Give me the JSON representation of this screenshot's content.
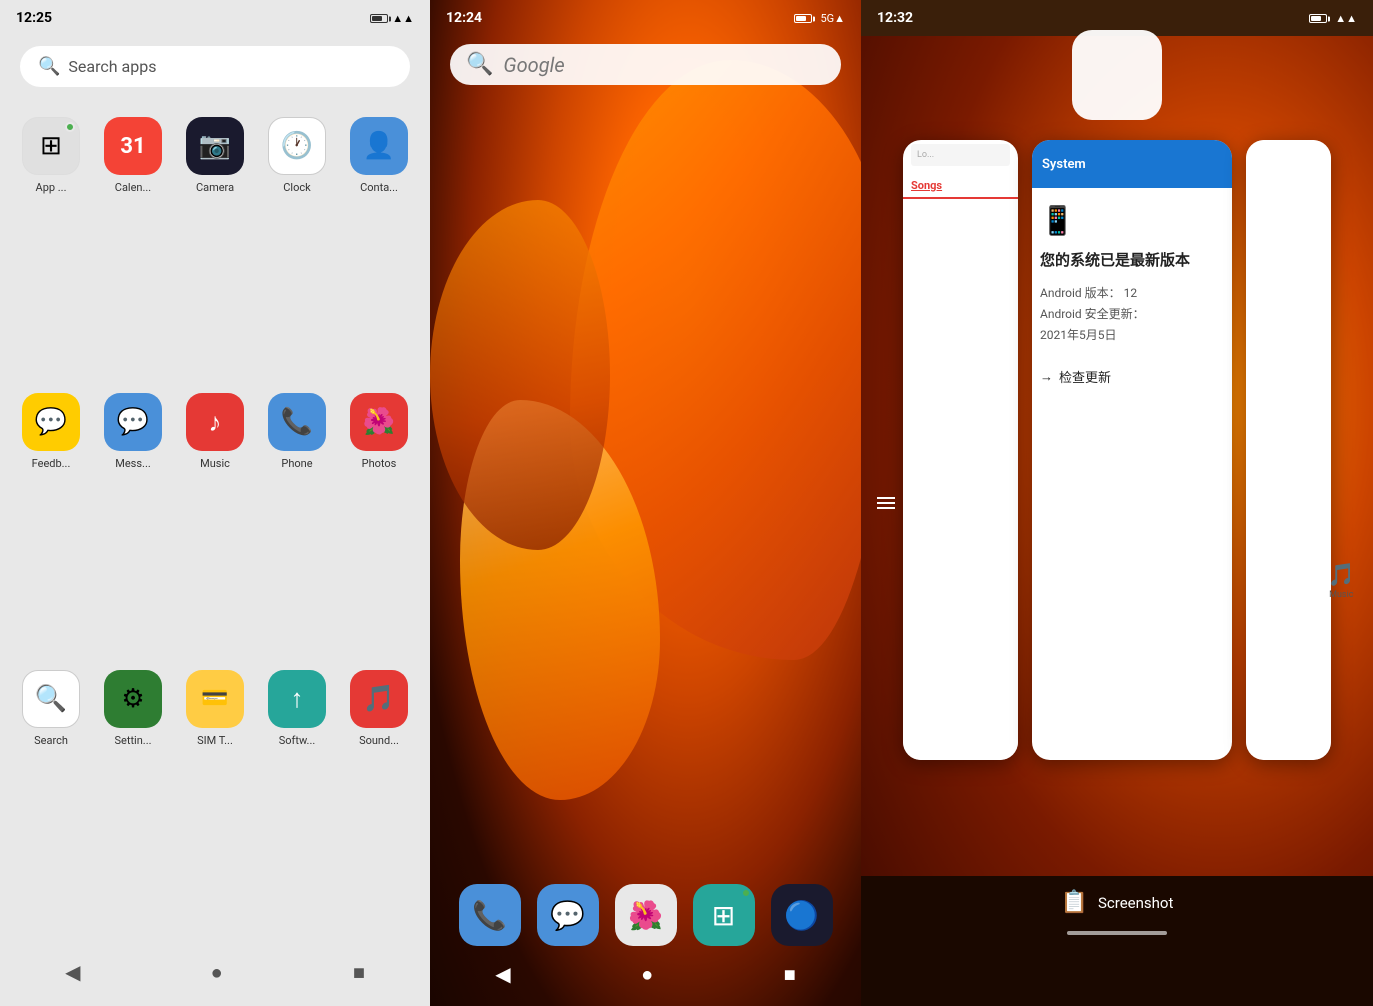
{
  "panel1": {
    "status": {
      "time": "12:25",
      "icons": "📶 🔋"
    },
    "search_placeholder": "Search apps",
    "apps": [
      {
        "id": "appstore",
        "label": "App ...",
        "icon": "⊞",
        "color": "#e8e8e8",
        "dot": true
      },
      {
        "id": "calendar",
        "label": "Calen...",
        "icon": "31",
        "color": "#f44336"
      },
      {
        "id": "camera",
        "label": "Camera",
        "icon": "📷",
        "color": "#1a1a2e"
      },
      {
        "id": "clock",
        "label": "Clock",
        "icon": "🕐",
        "color": "#ffffff"
      },
      {
        "id": "contacts",
        "label": "Conta...",
        "icon": "👤",
        "color": "#4a90d9"
      },
      {
        "id": "feedback",
        "label": "Feedb...",
        "icon": "💬",
        "color": "#ffcc00"
      },
      {
        "id": "messages",
        "label": "Mess...",
        "icon": "💬",
        "color": "#4a90d9"
      },
      {
        "id": "music",
        "label": "Music",
        "icon": "♪",
        "color": "#e53935"
      },
      {
        "id": "phone",
        "label": "Phone",
        "icon": "📞",
        "color": "#4a90d9"
      },
      {
        "id": "photos",
        "label": "Photos",
        "icon": "🌺",
        "color": "#e53935"
      },
      {
        "id": "search",
        "label": "Search",
        "icon": "🔍",
        "color": "#ffffff"
      },
      {
        "id": "settings",
        "label": "Settin...",
        "icon": "⚙",
        "color": "#2e7d32"
      },
      {
        "id": "simt",
        "label": "SIM T...",
        "icon": "💳",
        "color": "#ffcc44"
      },
      {
        "id": "software",
        "label": "Softw...",
        "icon": "↑",
        "color": "#26a69a"
      },
      {
        "id": "sound",
        "label": "Sound...",
        "icon": "🎵",
        "color": "#e53935"
      }
    ],
    "nav": {
      "back": "◀",
      "home": "●",
      "recents": "■"
    }
  },
  "panel2": {
    "status": {
      "time": "12:24",
      "icons": "* 5G 🔋"
    },
    "search": {
      "placeholder": "Google"
    },
    "dock": [
      {
        "id": "phone",
        "icon": "📞",
        "color": "#4a90d9"
      },
      {
        "id": "messages",
        "icon": "💬",
        "color": "#4a90d9"
      },
      {
        "id": "photos",
        "icon": "🌺",
        "color": "#e53935"
      },
      {
        "id": "appstore",
        "icon": "⊞",
        "color": "#26a69a",
        "dot": true
      },
      {
        "id": "camera",
        "icon": "🔵",
        "color": "#1a1a2e"
      }
    ],
    "nav": {
      "back": "◀",
      "home": "●",
      "recents": "■"
    }
  },
  "panel3": {
    "status": {
      "time": "12:32",
      "icons": "📶 🔋"
    },
    "recent_apps": {
      "system_update_title": "您的系统已是最新版本",
      "android_version_label": "Android 版本：",
      "android_version": "12",
      "android_security_label": "Android 安全更新：",
      "android_security_date": "2021年5月5日",
      "check_update_text": "检查更新",
      "songs_tab": "Songs"
    },
    "screenshot_label": "Screenshot",
    "nav": {
      "back": "◀",
      "home": "●",
      "recents": "■"
    }
  }
}
